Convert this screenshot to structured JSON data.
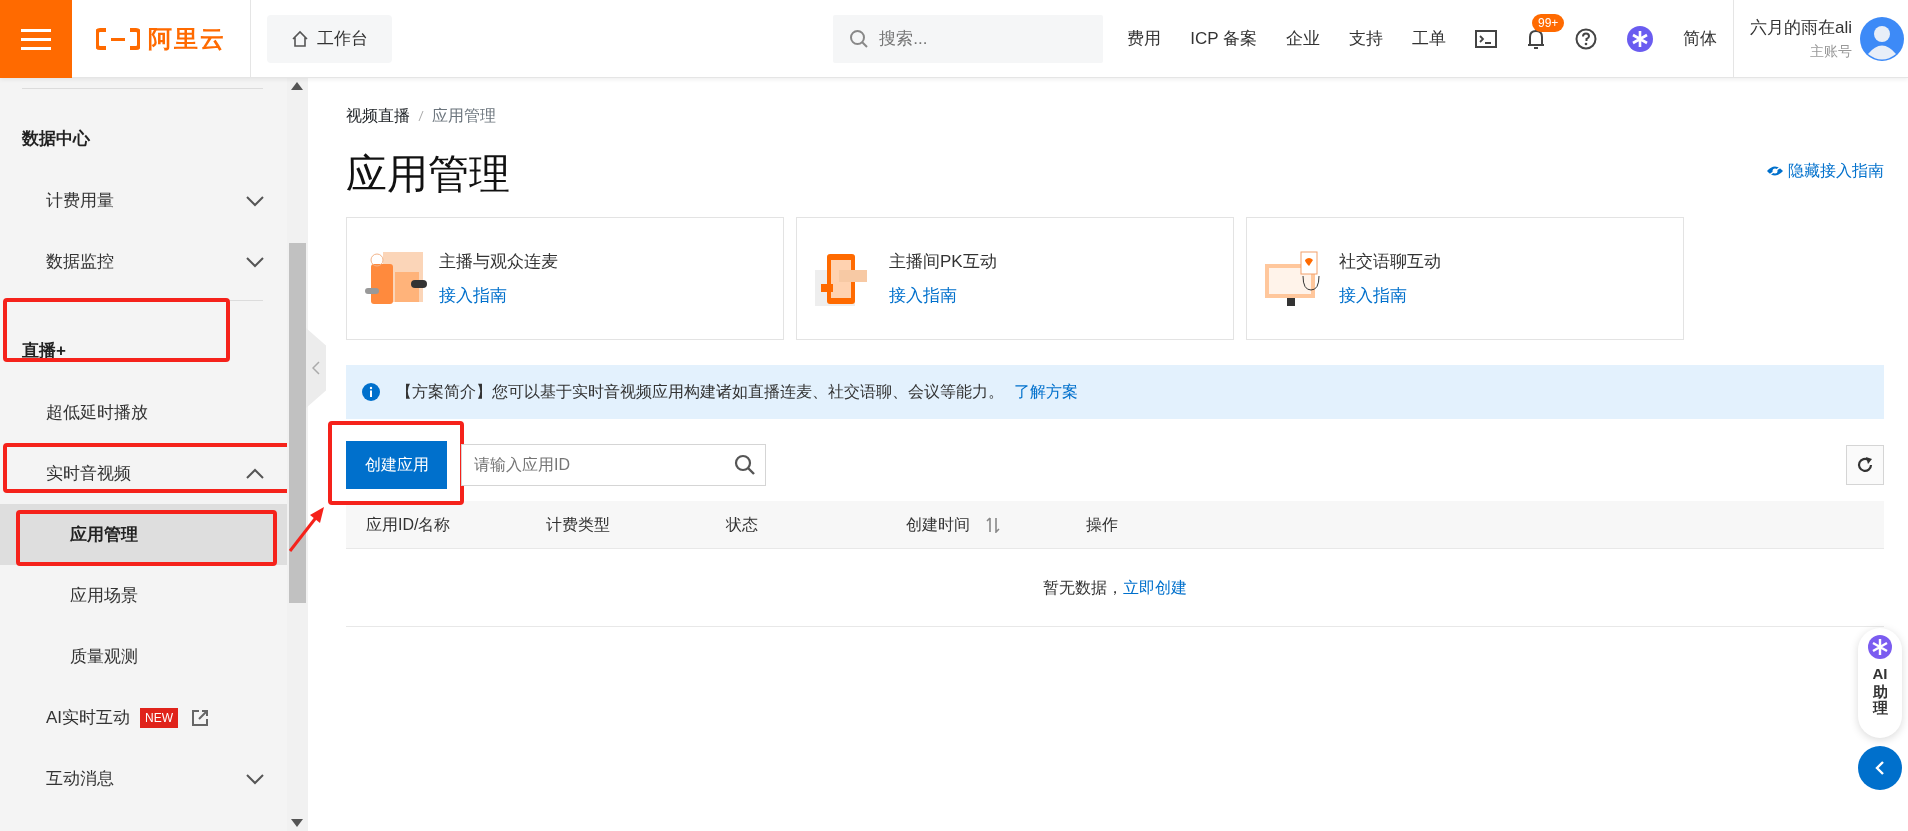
{
  "topbar": {
    "logo": "阿里云",
    "workbench": "工作台",
    "search": {
      "placeholder": "搜索..."
    },
    "links": [
      "费用",
      "ICP 备案",
      "企业",
      "支持",
      "工单"
    ],
    "notifications": "99+",
    "language": "简体",
    "user": {
      "name": "六月的雨在ali",
      "role": "主账号"
    }
  },
  "sidebar": {
    "items": [
      {
        "kind": "section",
        "label": "数据中心",
        "divider_before": true
      },
      {
        "kind": "item",
        "label": "计费用量",
        "expandable": true,
        "expanded": false
      },
      {
        "kind": "item",
        "label": "数据监控",
        "expandable": true,
        "expanded": false
      },
      {
        "kind": "section",
        "label": "直播+",
        "divider_before": true,
        "highlighted": true
      },
      {
        "kind": "item",
        "label": "超低延时播放",
        "expandable": false
      },
      {
        "kind": "item",
        "label": "实时音视频",
        "expandable": true,
        "expanded": true,
        "highlighted": true,
        "children": [
          {
            "label": "应用管理",
            "selected": true,
            "highlighted": true
          },
          {
            "label": "应用场景",
            "selected": false
          },
          {
            "label": "质量观测",
            "selected": false
          }
        ]
      },
      {
        "kind": "item",
        "label": "AI实时互动",
        "badge": "NEW",
        "external": true,
        "expandable": false
      },
      {
        "kind": "item",
        "label": "互动消息",
        "expandable": true,
        "expanded": false
      }
    ]
  },
  "breadcrumb": [
    "视频直播",
    "应用管理"
  ],
  "page_title": "应用管理",
  "hide_guide": "隐藏接入指南",
  "cards": [
    {
      "title": "主播与观众连麦",
      "link": "接入指南"
    },
    {
      "title": "主播间PK互动",
      "link": "接入指南"
    },
    {
      "title": "社交语聊互动",
      "link": "接入指南"
    }
  ],
  "notice": {
    "text": "【方案简介】您可以基于实时音视频应用构建诸如直播连麦、社交语聊、会议等能力。",
    "link": "了解方案"
  },
  "create_button": {
    "label": "创建应用",
    "highlighted": true
  },
  "filter": {
    "placeholder": "请输入应用ID"
  },
  "table": {
    "columns": [
      {
        "label": "应用ID/名称"
      },
      {
        "label": "计费类型"
      },
      {
        "label": "状态"
      },
      {
        "label": "创建时间",
        "sortable": true
      },
      {
        "label": "操作"
      }
    ],
    "empty": {
      "text": "暂无数据，",
      "link": "立即创建"
    }
  },
  "assistant": {
    "label": "AI",
    "label2": "助理"
  }
}
